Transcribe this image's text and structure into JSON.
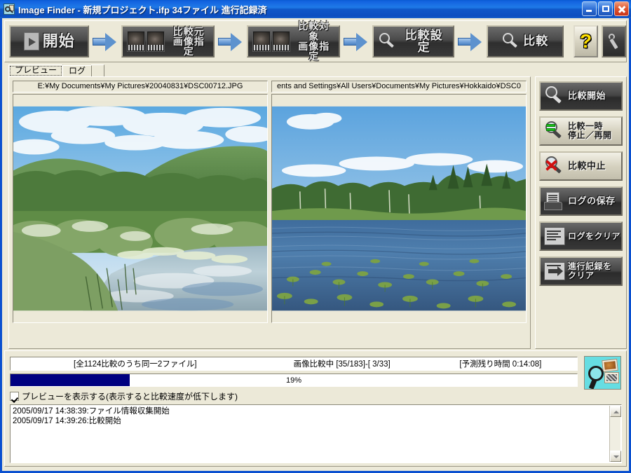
{
  "window": {
    "title": "Image Finder - 新規プロジェクト.ifp 34ファイル 進行記録済",
    "icon": "app-logo-icon",
    "controls": {
      "minimize": "—",
      "maximize": "□",
      "close": "✕"
    },
    "titlebar_color": "#1f7ae8"
  },
  "toolbar": {
    "buttons": [
      {
        "label": "開始",
        "icon": "play-document-icon"
      },
      {
        "label": "比較元\n画像指定",
        "icon": "image-pair-icon"
      },
      {
        "label": "比較対象\n画像指定",
        "icon": "image-pair-icon"
      },
      {
        "label": "比較設定",
        "icon": "wrench-magnifier-icon"
      },
      {
        "label": "比較",
        "icon": "magnifier-icon"
      }
    ],
    "help_label": "?",
    "settings_icon": "wrench-icon"
  },
  "tabs": [
    {
      "label": "プレビュー",
      "active": true
    },
    {
      "label": "ログ",
      "active": false
    }
  ],
  "preview": {
    "left": {
      "path": "E:¥My Documents¥My Pictures¥20040831¥DSC00712.JPG",
      "scene": "marsh-pond-green-hills"
    },
    "right": {
      "path": "ents and Settings¥All Users¥Documents¥My Pictures¥Hokkaido¥DSC0",
      "scene": "lake-with-aquatic-plants"
    }
  },
  "actions": [
    {
      "label": "比較開始",
      "icon": "magnifier-icon",
      "style": "dark"
    },
    {
      "label": "比較一時\n停止／再開",
      "icon": "magnifier-pause-icon",
      "style": "light"
    },
    {
      "label": "比較中止",
      "icon": "magnifier-stop-icon",
      "style": "light"
    },
    {
      "label": "ログの保存",
      "icon": "save-log-icon",
      "style": "dark"
    },
    {
      "label": "ログをクリア",
      "icon": "clear-log-icon",
      "style": "dark"
    },
    {
      "label": "進行記録を\nクリア",
      "icon": "clear-progress-icon",
      "style": "dark"
    }
  ],
  "status": {
    "total": "[全1124比較のうち同一2ファイル]",
    "current": "画像比較中 [35/183]-[ 3/33]",
    "remaining": "[予測残り時間 0:14:08]"
  },
  "progress": {
    "percent_label": "19%",
    "percent_value": 21
  },
  "checkbox": {
    "label": "プレビューを表示する(表示すると比較速度が低下します)",
    "checked": true
  },
  "log": {
    "lines": "2005/09/17 14:38:39:ファイル情報収集開始\n2005/09/17 14:39:26:比較開始"
  }
}
